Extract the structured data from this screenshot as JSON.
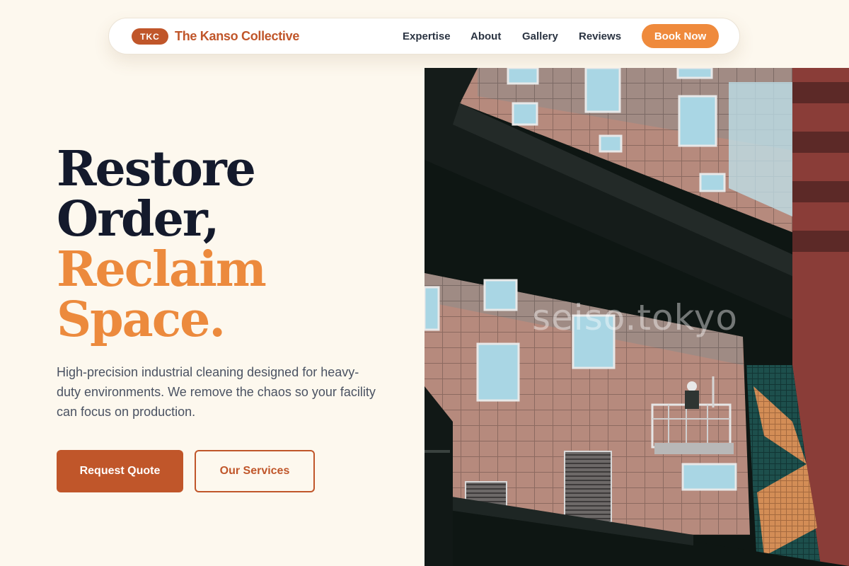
{
  "nav": {
    "logo_badge": "TKC",
    "brand_name": "The Kanso Collective",
    "links": [
      "Expertise",
      "About",
      "Gallery",
      "Reviews"
    ],
    "cta": "Book Now"
  },
  "hero": {
    "headline": [
      "Restore",
      "Order,",
      "Reclaim",
      "Space."
    ],
    "subtitle": "High-precision industrial cleaning designed for heavy-duty environments. We remove the chaos so your facility can focus on production.",
    "primary_button": "Request Quote",
    "secondary_button": "Our Services"
  },
  "image": {
    "watermark": "seiso.tokyo",
    "subject": "window-cleaning-gondola-on-building"
  },
  "colors": {
    "brand": "#c0562a",
    "accent": "#ec8a3d",
    "cta": "#ef8a3c",
    "heading": "#141a2c",
    "background": "#fdf8ee"
  }
}
